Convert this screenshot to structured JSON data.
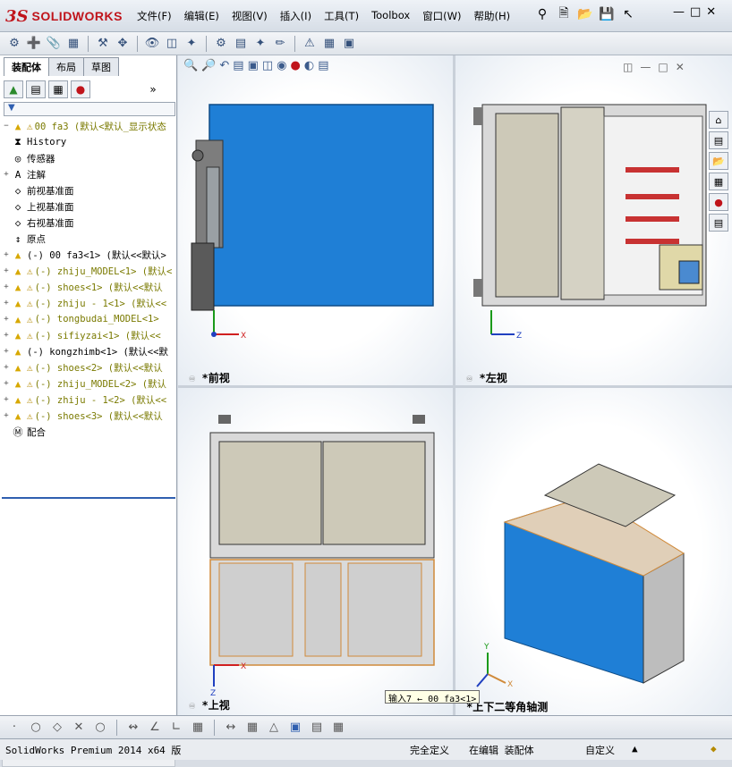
{
  "app": {
    "brand_ds": "3S",
    "brand_name": "SOLIDWORKS"
  },
  "menu": [
    "文件(F)",
    "编辑(E)",
    "视图(V)",
    "插入(I)",
    "工具(T)",
    "Toolbox",
    "窗口(W)",
    "帮助(H)"
  ],
  "tabs": [
    "装配体",
    "布局",
    "草图"
  ],
  "tree": {
    "root": "00 fa3  (默认<默认_显示状态",
    "items": [
      {
        "label": "History",
        "icon": "history-icon",
        "olive": false,
        "expand": ""
      },
      {
        "label": "传感器",
        "icon": "sensor-icon",
        "olive": false,
        "expand": ""
      },
      {
        "label": "注解",
        "icon": "annotation-icon",
        "olive": false,
        "expand": "+"
      },
      {
        "label": "前视基准面",
        "icon": "plane-icon",
        "olive": false,
        "expand": ""
      },
      {
        "label": "上视基准面",
        "icon": "plane-icon",
        "olive": false,
        "expand": ""
      },
      {
        "label": "右视基准面",
        "icon": "plane-icon",
        "olive": false,
        "expand": ""
      },
      {
        "label": "原点",
        "icon": "origin-icon",
        "olive": false,
        "expand": ""
      },
      {
        "label": "(-) 00 fa3<1> (默认<<默认>",
        "icon": "part-icon",
        "olive": false,
        "expand": "+",
        "warn": false
      },
      {
        "label": "(-) zhiju_MODEL<1> (默认<",
        "icon": "part-icon",
        "olive": true,
        "expand": "+",
        "warn": true
      },
      {
        "label": "(-) shoes<1> (默认<<默认",
        "icon": "part-icon",
        "olive": true,
        "expand": "+",
        "warn": true
      },
      {
        "label": "(-) zhiju - 1<1> (默认<<",
        "icon": "part-icon",
        "olive": true,
        "expand": "+",
        "warn": true
      },
      {
        "label": "(-) tongbudai_MODEL<1>",
        "icon": "part-icon",
        "olive": true,
        "expand": "+",
        "warn": true
      },
      {
        "label": "(-) sifiyzai<1> (默认<<",
        "icon": "part-icon",
        "olive": true,
        "expand": "+",
        "warn": true
      },
      {
        "label": "(-) kongzhimb<1> (默认<<默",
        "icon": "part-icon",
        "olive": false,
        "expand": "+",
        "warn": false
      },
      {
        "label": "(-) shoes<2> (默认<<默认",
        "icon": "part-icon",
        "olive": true,
        "expand": "+",
        "warn": true
      },
      {
        "label": "(-) zhiju_MODEL<2> (默认",
        "icon": "part-icon",
        "olive": true,
        "expand": "+",
        "warn": true
      },
      {
        "label": "(-) zhiju - 1<2> (默认<<",
        "icon": "part-icon",
        "olive": true,
        "expand": "+",
        "warn": true
      },
      {
        "label": "(-) shoes<3> (默认<<默认",
        "icon": "part-icon",
        "olive": true,
        "expand": "+",
        "warn": true
      },
      {
        "label": "配合",
        "icon": "mate-icon",
        "olive": false,
        "expand": ""
      }
    ]
  },
  "views": {
    "front": "*前视",
    "left": "*左视",
    "top": "*上视",
    "iso": "*上下二等角轴测"
  },
  "axes": {
    "x": "X",
    "y": "Y",
    "z": "Z"
  },
  "tooltip": "输入7 ← 00 fa3<1>",
  "status": {
    "product": "SolidWorks Premium 2014 x64 版",
    "defined": "完全定义",
    "editing": "在编辑 装配体",
    "custom": "自定义"
  },
  "colors": {
    "panel_blue": "#1f7fd6",
    "cabinet_gray": "#c9c9c9",
    "door_beige": "#cdc9b8",
    "frame_orange": "#d08a3a"
  }
}
